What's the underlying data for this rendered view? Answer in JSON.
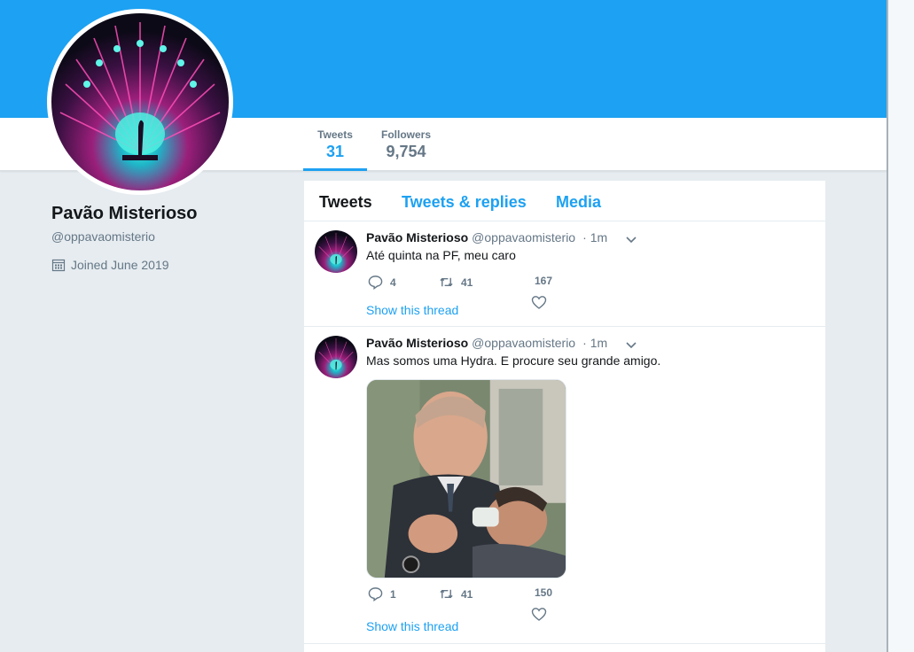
{
  "profile": {
    "name": "Pavão Misterioso",
    "handle": "@oppavaomisterio",
    "joined": "Joined June 2019"
  },
  "stats": {
    "tweets_label": "Tweets",
    "tweets_value": "31",
    "followers_label": "Followers",
    "followers_value": "9,754"
  },
  "tabs": [
    {
      "label": "Tweets",
      "active": true
    },
    {
      "label": "Tweets & replies",
      "active": false
    },
    {
      "label": "Media",
      "active": false
    }
  ],
  "tweets": [
    {
      "name": "Pavão Misterioso",
      "handle": "@oppavaomisterio",
      "dot": "·",
      "time": "1m",
      "text": "Até quinta na PF, meu caro",
      "replies": "4",
      "retweets": "41",
      "likes": "167",
      "show_thread": "Show this thread",
      "has_media": false
    },
    {
      "name": "Pavão Misterioso",
      "handle": "@oppavaomisterio",
      "dot": "·",
      "time": "1m",
      "text": "Mas somos uma Hydra. E procure seu grande amigo.",
      "replies": "1",
      "retweets": "41",
      "likes": "150",
      "show_thread": "Show this thread",
      "has_media": true
    }
  ],
  "icons": {
    "calendar": "calendar-icon",
    "reply": "reply-icon",
    "retweet": "retweet-icon",
    "like": "heart-icon",
    "caret": "chevron-down-icon"
  },
  "colors": {
    "brand": "#1da1f2",
    "background": "#e6ecf0",
    "muted_text": "#657786",
    "text": "#14171a"
  }
}
